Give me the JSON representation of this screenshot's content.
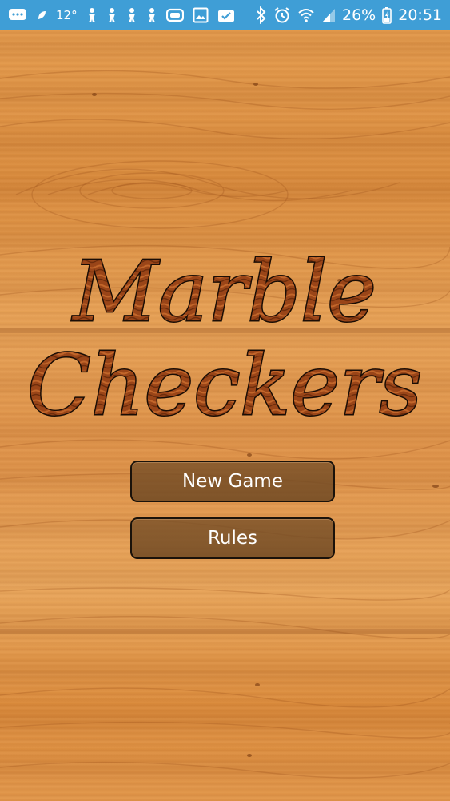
{
  "status_bar": {
    "temperature": "12°",
    "battery_percent": "26%",
    "time": "20:51",
    "left_icons": [
      "chat-bubble-icon",
      "leaf-icon",
      "weather-icon",
      "figure-icon",
      "figure-icon",
      "figure-icon",
      "figure-icon",
      "vr-icon",
      "image-icon",
      "clipboard-check-icon"
    ],
    "right_icons": [
      "bluetooth-icon",
      "alarm-icon",
      "wifi-icon",
      "signal-icon",
      "battery-icon"
    ],
    "colors": {
      "background": "#3f9ed6",
      "foreground": "#ffffff"
    }
  },
  "game": {
    "title_line1": "Marble",
    "title_line2": "Checkers",
    "menu": {
      "new_game_label": "New Game",
      "rules_label": "Rules"
    },
    "colors": {
      "wood": "#d98b3a",
      "title_fill": "#8a3b14",
      "title_outline": "#1a0d05",
      "button_fill": "#7a5028"
    }
  }
}
